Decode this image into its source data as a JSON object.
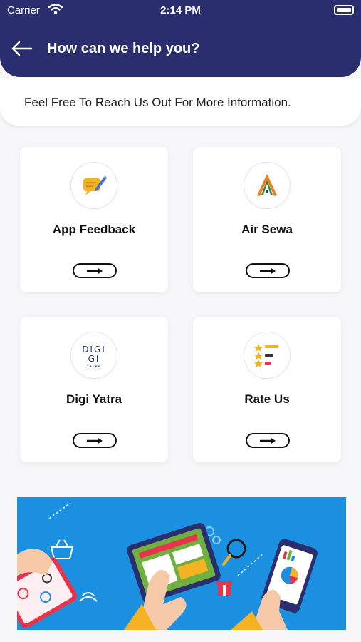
{
  "status": {
    "carrier": "Carrier",
    "time": "2:14 PM"
  },
  "header": {
    "title": "How can we help you?"
  },
  "info": {
    "text": "Feel Free To Reach Us Out For More Information."
  },
  "cards": [
    {
      "label": "App Feedback",
      "icon": "feedback-icon"
    },
    {
      "label": "Air Sewa",
      "icon": "air-sewa-logo-icon"
    },
    {
      "label": "Digi Yatra",
      "icon": "digi-yatra-logo-icon",
      "logo_text": "DIGI",
      "logo_sub": "YATRA"
    },
    {
      "label": "Rate Us",
      "icon": "rate-us-icon"
    }
  ],
  "colors": {
    "header": "#2a2d6e",
    "illustration_bg": "#1b8fe0"
  }
}
